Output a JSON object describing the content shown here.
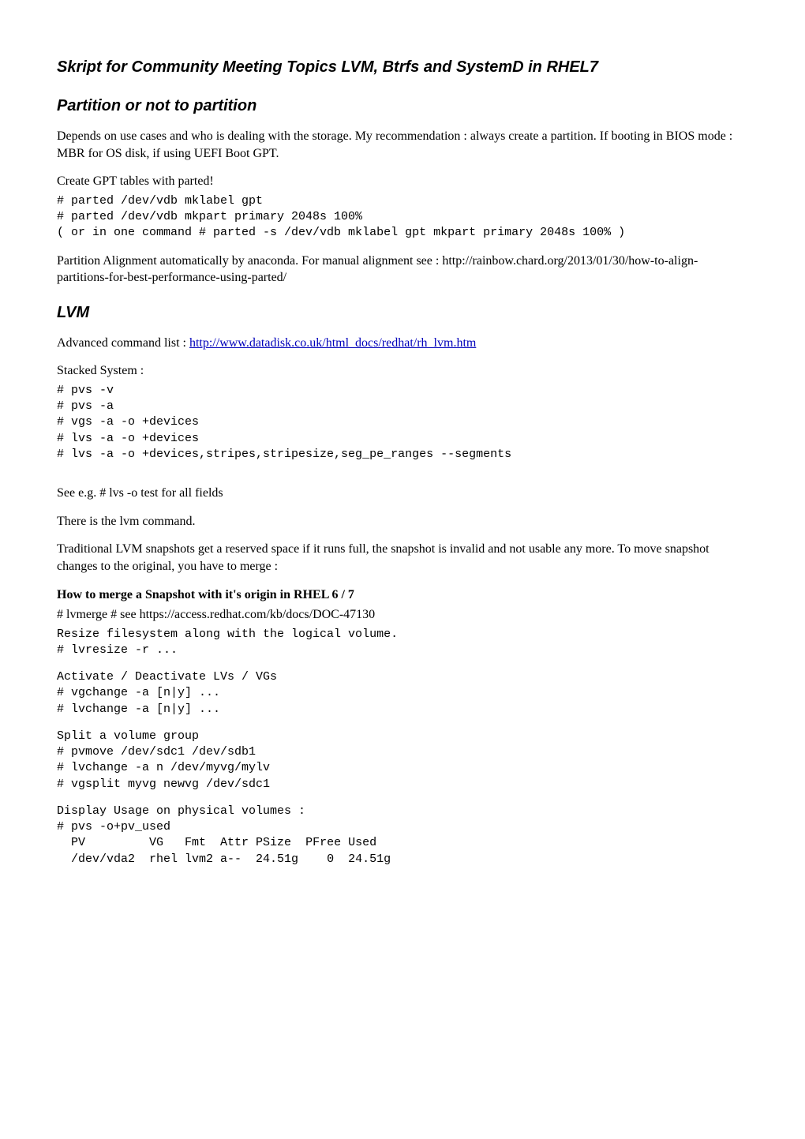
{
  "title": "Skript for Community Meeting Topics LVM, Btrfs and SystemD in RHEL7",
  "sections": {
    "partition": {
      "heading": "Partition or not to partition",
      "p1": "Depends on use cases and who is dealing with the storage. My recommendation : always create a partition. If booting in BIOS mode : MBR for OS disk, if using UEFI Boot GPT.",
      "p2": "Create GPT tables with parted!",
      "code1_l1": "# parted /dev/vdb mklabel gpt",
      "code1_l2": "# parted /dev/vdb mkpart primary 2048s 100%",
      "code1_l3": "( or in one command # parted -s /dev/vdb mklabel gpt mkpart primary 2048s 100% )",
      "p3": "Partition Alignment automatically by anaconda. For manual alignment see : http://rainbow.chard.org/2013/01/30/how-to-align-partitions-for-best-performance-using-parted/"
    },
    "lvm": {
      "heading": "LVM",
      "p1_prefix": "Advanced command list : ",
      "p1_link": "http://www.datadisk.co.uk/html_docs/redhat/rh_lvm.htm",
      "p2": "Stacked System :",
      "code1_l1": "# pvs -v",
      "code1_l2": "# pvs -a",
      "code1_l3": "# vgs -a -o +devices",
      "code1_l4": "# lvs -a -o +devices",
      "code1_l5": "# lvs -a -o +devices,stripes,stripesize,seg_pe_ranges --segments",
      "p3": "See e.g. # lvs -o test for all fields",
      "p4": "There is the lvm command.",
      "p5": "Traditional LVM snapshots get a reserved space if it runs full, the snapshot is invalid and not usable any more. To move snapshot changes to the original, you have to merge :",
      "merge_heading": "How to merge a Snapshot with it's origin in RHEL 6 / 7",
      "merge_line": "# lvmerge # see https://access.redhat.com/kb/docs/DOC-47130",
      "code2_l1": "Resize filesystem along with the logical volume.",
      "code2_l2": "# lvresize -r ...",
      "code3_l1": "Activate / Deactivate LVs / VGs",
      "code3_l2": "# vgchange -a [n|y] ...",
      "code3_l3": "# lvchange -a [n|y] ...",
      "code4_l1": "Split a volume group",
      "code4_l2": "# pvmove /dev/sdc1 /dev/sdb1",
      "code4_l3": "# lvchange -a n /dev/myvg/mylv",
      "code4_l4": "# vgsplit myvg newvg /dev/sdc1",
      "code5_l1": "Display Usage on physical volumes :",
      "code5_l2": "# pvs -o+pv_used",
      "code5_l3": "  PV         VG   Fmt  Attr PSize  PFree Used",
      "code5_l4": "  /dev/vda2  rhel lvm2 a--  24.51g    0  24.51g"
    }
  }
}
